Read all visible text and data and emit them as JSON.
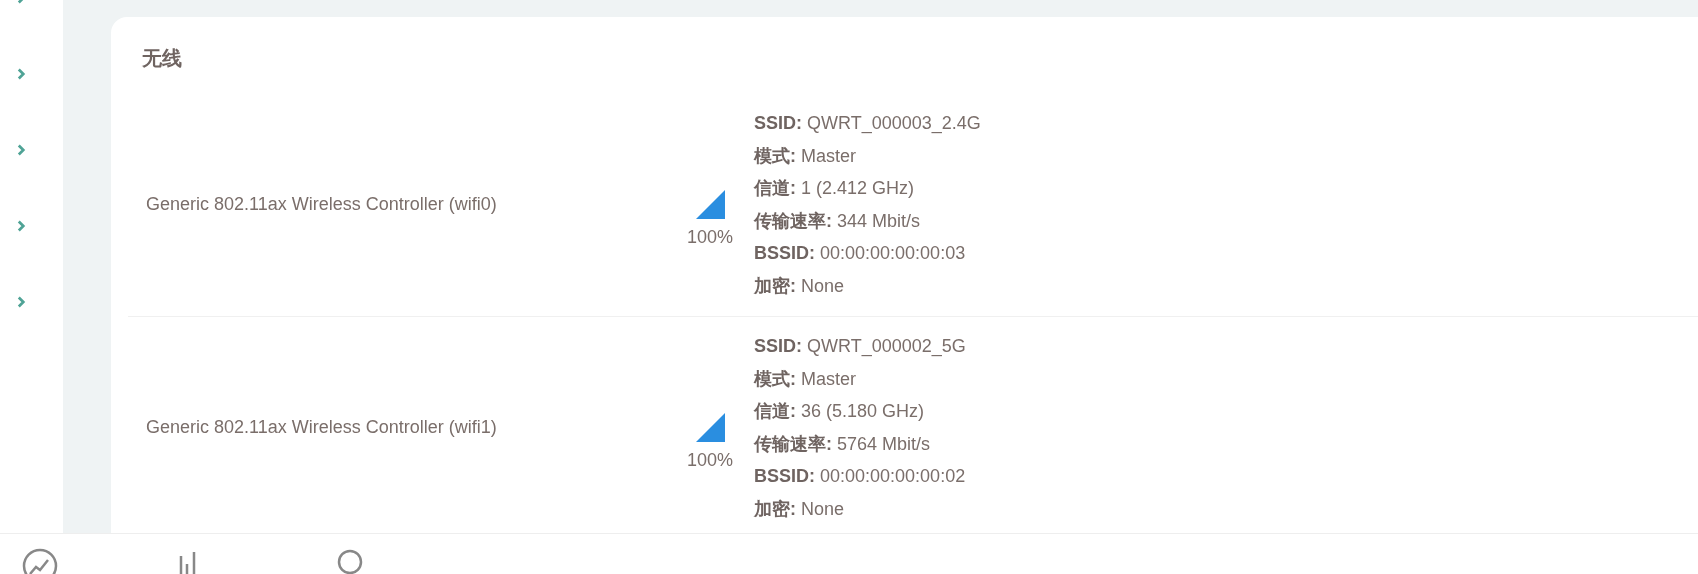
{
  "section": {
    "title": "无线"
  },
  "radios": [
    {
      "name": "Generic 802.11ax Wireless Controller (wifi0)",
      "signal": "100%",
      "details": [
        {
          "label": "SSID:",
          "value": "QWRT_000003_2.4G"
        },
        {
          "label": "模式:",
          "value": "Master"
        },
        {
          "label": "信道:",
          "value": "1 (2.412 GHz)"
        },
        {
          "label": "传输速率:",
          "value": "344 Mbit/s"
        },
        {
          "label": "BSSID:",
          "value": "00:00:00:00:00:03"
        },
        {
          "label": "加密:",
          "value": "None"
        }
      ]
    },
    {
      "name": "Generic 802.11ax Wireless Controller (wifi1)",
      "signal": "100%",
      "details": [
        {
          "label": "SSID:",
          "value": "QWRT_000002_5G"
        },
        {
          "label": "模式:",
          "value": "Master"
        },
        {
          "label": "信道:",
          "value": "36 (5.180 GHz)"
        },
        {
          "label": "传输速率:",
          "value": "5764 Mbit/s"
        },
        {
          "label": "BSSID:",
          "value": "00:00:00:00:00:02"
        },
        {
          "label": "加密:",
          "value": "None"
        }
      ]
    }
  ]
}
